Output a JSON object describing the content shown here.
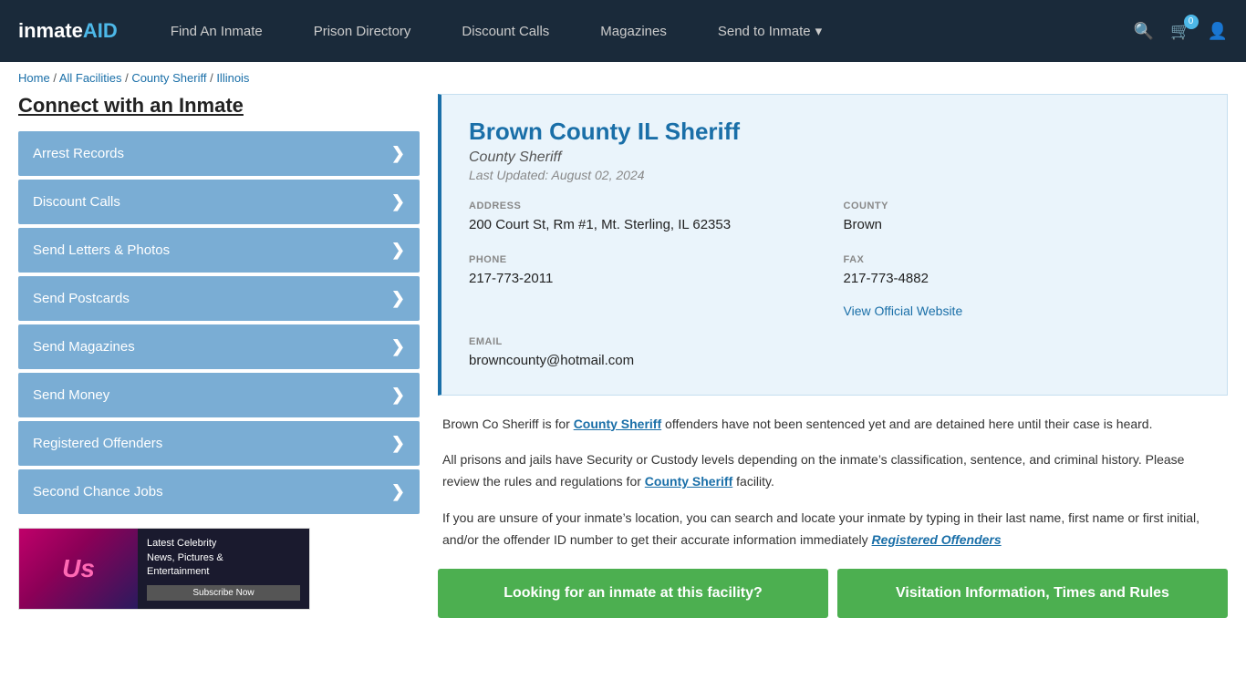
{
  "nav": {
    "logo": "inmateAID",
    "logo_colored": "AID",
    "links": [
      {
        "label": "Find An Inmate",
        "id": "find-inmate"
      },
      {
        "label": "Prison Directory",
        "id": "prison-directory"
      },
      {
        "label": "Discount Calls",
        "id": "discount-calls"
      },
      {
        "label": "Magazines",
        "id": "magazines"
      },
      {
        "label": "Send to Inmate",
        "id": "send-to-inmate",
        "dropdown": true
      }
    ],
    "cart_count": "0"
  },
  "breadcrumb": {
    "items": [
      "Home",
      "All Facilities",
      "County Sheriff",
      "Illinois"
    ]
  },
  "sidebar": {
    "title": "Connect with an Inmate",
    "menu_items": [
      {
        "label": "Arrest Records"
      },
      {
        "label": "Discount Calls"
      },
      {
        "label": "Send Letters & Photos"
      },
      {
        "label": "Send Postcards"
      },
      {
        "label": "Send Magazines"
      },
      {
        "label": "Send Money"
      },
      {
        "label": "Registered Offenders"
      },
      {
        "label": "Second Chance Jobs"
      }
    ]
  },
  "facility": {
    "name": "Brown County IL Sheriff",
    "type": "County Sheriff",
    "last_updated": "Last Updated: August 02, 2024",
    "address_label": "ADDRESS",
    "address_value": "200 Court St, Rm #1, Mt. Sterling, IL 62353",
    "county_label": "COUNTY",
    "county_value": "Brown",
    "phone_label": "PHONE",
    "phone_value": "217-773-2011",
    "fax_label": "FAX",
    "fax_value": "217-773-4882",
    "email_label": "EMAIL",
    "email_value": "browncounty@hotmail.com",
    "website_label": "View Official Website"
  },
  "description": {
    "para1_before": "Brown Co Sheriff is for ",
    "para1_highlight": "County Sheriff",
    "para1_after": " offenders have not been sentenced yet and are detained here until their case is heard.",
    "para2": "All prisons and jails have Security or Custody levels depending on the inmate’s classification, sentence, and criminal history. Please review the rules and regulations for ",
    "para2_highlight": "County Sheriff",
    "para2_after": " facility.",
    "para3": "If you are unsure of your inmate’s location, you can search and locate your inmate by typing in their last name, first name or first initial, and/or the offender ID number to get their accurate information immediately",
    "para3_highlight": "Registered Offenders"
  },
  "buttons": {
    "looking": "Looking for an inmate at this facility?",
    "visitation": "Visitation Information, Times and Rules"
  },
  "ad": {
    "logo": "Us",
    "line1": "Latest Celebrity",
    "line2": "News, Pictures &",
    "line3": "Entertainment",
    "btn": "Subscribe Now"
  }
}
